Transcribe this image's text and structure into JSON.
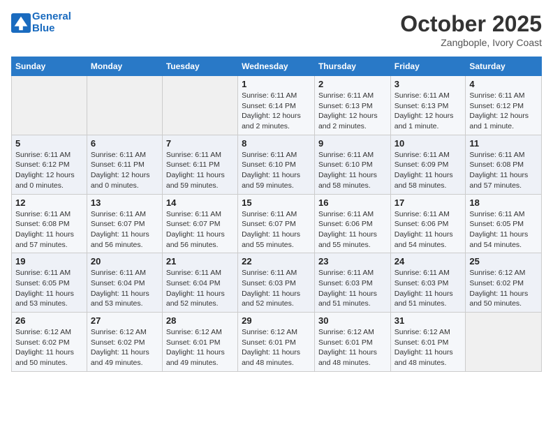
{
  "header": {
    "logo_line1": "General",
    "logo_line2": "Blue",
    "title": "October 2025",
    "subtitle": "Zangbople, Ivory Coast"
  },
  "days_of_week": [
    "Sunday",
    "Monday",
    "Tuesday",
    "Wednesday",
    "Thursday",
    "Friday",
    "Saturday"
  ],
  "weeks": [
    [
      {
        "num": "",
        "info": ""
      },
      {
        "num": "",
        "info": ""
      },
      {
        "num": "",
        "info": ""
      },
      {
        "num": "1",
        "info": "Sunrise: 6:11 AM\nSunset: 6:14 PM\nDaylight: 12 hours and 2 minutes."
      },
      {
        "num": "2",
        "info": "Sunrise: 6:11 AM\nSunset: 6:13 PM\nDaylight: 12 hours and 2 minutes."
      },
      {
        "num": "3",
        "info": "Sunrise: 6:11 AM\nSunset: 6:13 PM\nDaylight: 12 hours and 1 minute."
      },
      {
        "num": "4",
        "info": "Sunrise: 6:11 AM\nSunset: 6:12 PM\nDaylight: 12 hours and 1 minute."
      }
    ],
    [
      {
        "num": "5",
        "info": "Sunrise: 6:11 AM\nSunset: 6:12 PM\nDaylight: 12 hours and 0 minutes."
      },
      {
        "num": "6",
        "info": "Sunrise: 6:11 AM\nSunset: 6:11 PM\nDaylight: 12 hours and 0 minutes."
      },
      {
        "num": "7",
        "info": "Sunrise: 6:11 AM\nSunset: 6:11 PM\nDaylight: 11 hours and 59 minutes."
      },
      {
        "num": "8",
        "info": "Sunrise: 6:11 AM\nSunset: 6:10 PM\nDaylight: 11 hours and 59 minutes."
      },
      {
        "num": "9",
        "info": "Sunrise: 6:11 AM\nSunset: 6:10 PM\nDaylight: 11 hours and 58 minutes."
      },
      {
        "num": "10",
        "info": "Sunrise: 6:11 AM\nSunset: 6:09 PM\nDaylight: 11 hours and 58 minutes."
      },
      {
        "num": "11",
        "info": "Sunrise: 6:11 AM\nSunset: 6:08 PM\nDaylight: 11 hours and 57 minutes."
      }
    ],
    [
      {
        "num": "12",
        "info": "Sunrise: 6:11 AM\nSunset: 6:08 PM\nDaylight: 11 hours and 57 minutes."
      },
      {
        "num": "13",
        "info": "Sunrise: 6:11 AM\nSunset: 6:07 PM\nDaylight: 11 hours and 56 minutes."
      },
      {
        "num": "14",
        "info": "Sunrise: 6:11 AM\nSunset: 6:07 PM\nDaylight: 11 hours and 56 minutes."
      },
      {
        "num": "15",
        "info": "Sunrise: 6:11 AM\nSunset: 6:07 PM\nDaylight: 11 hours and 55 minutes."
      },
      {
        "num": "16",
        "info": "Sunrise: 6:11 AM\nSunset: 6:06 PM\nDaylight: 11 hours and 55 minutes."
      },
      {
        "num": "17",
        "info": "Sunrise: 6:11 AM\nSunset: 6:06 PM\nDaylight: 11 hours and 54 minutes."
      },
      {
        "num": "18",
        "info": "Sunrise: 6:11 AM\nSunset: 6:05 PM\nDaylight: 11 hours and 54 minutes."
      }
    ],
    [
      {
        "num": "19",
        "info": "Sunrise: 6:11 AM\nSunset: 6:05 PM\nDaylight: 11 hours and 53 minutes."
      },
      {
        "num": "20",
        "info": "Sunrise: 6:11 AM\nSunset: 6:04 PM\nDaylight: 11 hours and 53 minutes."
      },
      {
        "num": "21",
        "info": "Sunrise: 6:11 AM\nSunset: 6:04 PM\nDaylight: 11 hours and 52 minutes."
      },
      {
        "num": "22",
        "info": "Sunrise: 6:11 AM\nSunset: 6:03 PM\nDaylight: 11 hours and 52 minutes."
      },
      {
        "num": "23",
        "info": "Sunrise: 6:11 AM\nSunset: 6:03 PM\nDaylight: 11 hours and 51 minutes."
      },
      {
        "num": "24",
        "info": "Sunrise: 6:11 AM\nSunset: 6:03 PM\nDaylight: 11 hours and 51 minutes."
      },
      {
        "num": "25",
        "info": "Sunrise: 6:12 AM\nSunset: 6:02 PM\nDaylight: 11 hours and 50 minutes."
      }
    ],
    [
      {
        "num": "26",
        "info": "Sunrise: 6:12 AM\nSunset: 6:02 PM\nDaylight: 11 hours and 50 minutes."
      },
      {
        "num": "27",
        "info": "Sunrise: 6:12 AM\nSunset: 6:02 PM\nDaylight: 11 hours and 49 minutes."
      },
      {
        "num": "28",
        "info": "Sunrise: 6:12 AM\nSunset: 6:01 PM\nDaylight: 11 hours and 49 minutes."
      },
      {
        "num": "29",
        "info": "Sunrise: 6:12 AM\nSunset: 6:01 PM\nDaylight: 11 hours and 48 minutes."
      },
      {
        "num": "30",
        "info": "Sunrise: 6:12 AM\nSunset: 6:01 PM\nDaylight: 11 hours and 48 minutes."
      },
      {
        "num": "31",
        "info": "Sunrise: 6:12 AM\nSunset: 6:01 PM\nDaylight: 11 hours and 48 minutes."
      },
      {
        "num": "",
        "info": ""
      }
    ]
  ]
}
